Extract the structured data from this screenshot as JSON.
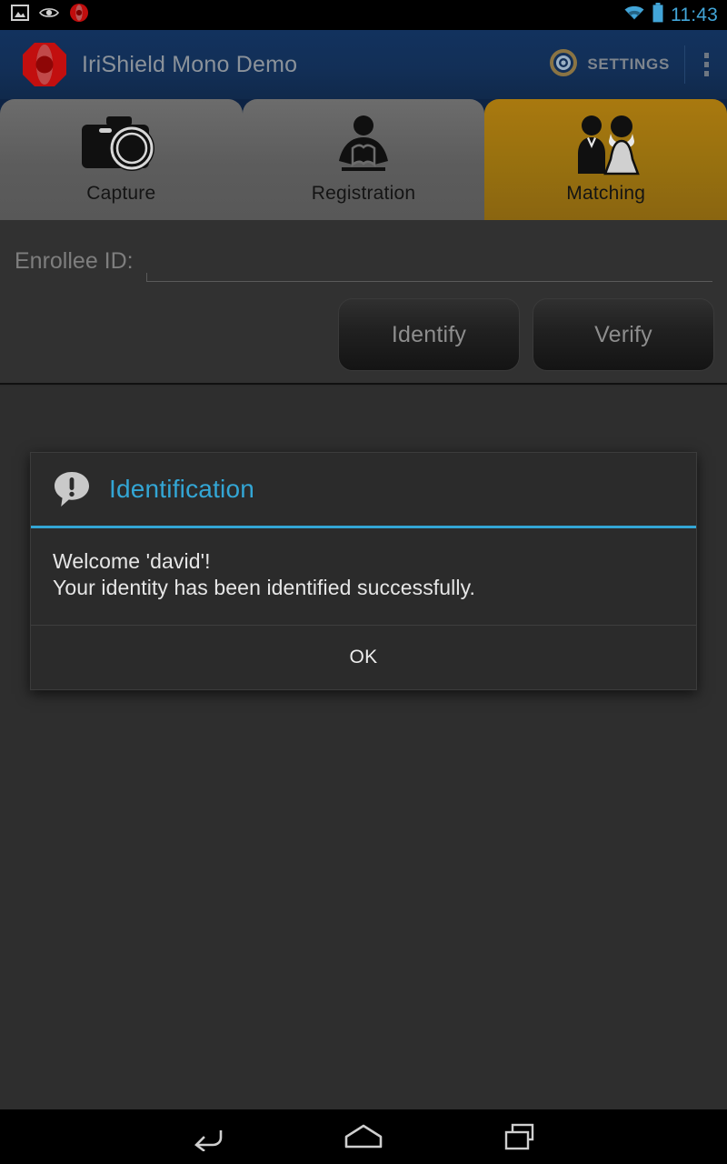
{
  "status_bar": {
    "left_icons": [
      "image-icon",
      "eye-icon",
      "iris-logo-icon"
    ],
    "right_icons": [
      "wifi-icon",
      "battery-icon"
    ],
    "time": "11:43",
    "accent_color": "#42a5d8"
  },
  "app_bar": {
    "logo_icon": "irishield-logo-icon",
    "title": "IriShield Mono Demo",
    "settings_icon": "settings-iris-icon",
    "settings_label": "SETTINGS",
    "overflow_icon": "overflow-menu-icon",
    "background_color": "#12325e"
  },
  "tabs": {
    "active_index": 2,
    "active_color": "#97700f",
    "inactive_color": "#5c5c5c",
    "items": [
      {
        "label": "Capture",
        "icon": "camera-icon",
        "selected": false
      },
      {
        "label": "Registration",
        "icon": "person-reading-icon",
        "selected": false
      },
      {
        "label": "Matching",
        "icon": "couple-icon",
        "selected": true
      }
    ]
  },
  "form": {
    "enrollee_label": "Enrollee ID:",
    "enrollee_value": "",
    "enrollee_placeholder": "",
    "identify_button": "Identify",
    "verify_button": "Verify"
  },
  "dialog": {
    "icon": "speech-bubble-alert-icon",
    "title": "Identification",
    "accent_color": "#33a6d5",
    "message_lines": [
      "Welcome 'david'!",
      "Your identity has been identified successfully."
    ],
    "ok_button": "OK"
  },
  "nav_bar": {
    "buttons": [
      {
        "name": "back-icon"
      },
      {
        "name": "home-icon"
      },
      {
        "name": "recents-icon"
      }
    ]
  }
}
